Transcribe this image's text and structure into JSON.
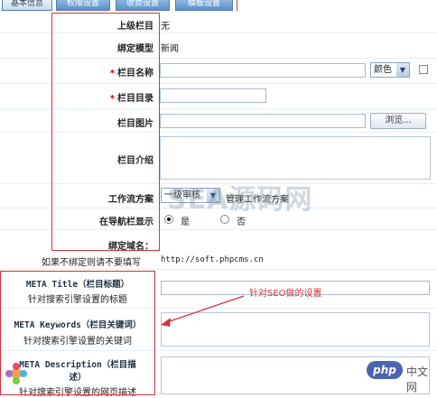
{
  "tabs": [
    {
      "label": "基本信息",
      "active": true
    },
    {
      "label": "权限设置",
      "active": false
    },
    {
      "label": "收费设置",
      "active": false
    },
    {
      "label": "模板设置",
      "active": false
    }
  ],
  "form": {
    "parent_label": "上级栏目",
    "parent_value": "无",
    "model_label": "绑定模型",
    "model_value": "新闻",
    "name_label": "栏目名称",
    "name_required": "*",
    "color_select": "颜色",
    "dir_label": "栏目目录",
    "dir_required": "*",
    "image_label": "栏目图片",
    "browse_button": "浏览...",
    "intro_label": "栏目介绍",
    "workflow_label": "工作流方案",
    "workflow_select": "一级审核",
    "workflow_link": "管理工作流方案",
    "nav_label": "在导航栏显示",
    "nav_yes": "是",
    "nav_no": "否",
    "domain_label": "绑定域名：",
    "domain_hint": "如果不绑定则请不要填写",
    "domain_example": "http://soft.phpcms.cn"
  },
  "seo": {
    "title_label": "META Title（栏目标题）",
    "title_hint": "针对搜索引擎设置的标题",
    "keywords_label": "META Keywords（栏目关键词）",
    "keywords_hint": "针对搜索引擎设置的关键词",
    "desc_label_1": "META Description（栏目描",
    "desc_label_2": "述）",
    "desc_hint": "针对搜索引擎设置的网页描述"
  },
  "annotation": {
    "text": "针对SEO做的设置",
    "color": "#d9323a"
  },
  "watermark": {
    "text": "SEA源码网"
  },
  "logo": {
    "text": "中文网",
    "brand": "php",
    "brand_color": "#4a64b0"
  }
}
